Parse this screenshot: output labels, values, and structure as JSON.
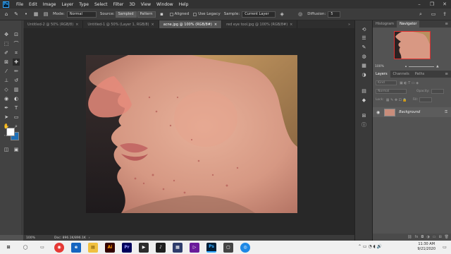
{
  "app": {
    "logo": "Ps"
  },
  "menu": [
    "File",
    "Edit",
    "Image",
    "Layer",
    "Type",
    "Select",
    "Filter",
    "3D",
    "View",
    "Window",
    "Help"
  ],
  "options": {
    "mode_label": "Mode:",
    "mode_value": "Normal",
    "source_label": "Source:",
    "sampled_label": "Sampled",
    "pattern_label": "Pattern",
    "aligned_label": "Aligned",
    "legacy_label": "Use Legacy",
    "sample_label": "Sample:",
    "sample_value": "Current Layer",
    "diffusion_label": "Diffusion:",
    "diffusion_value": "5"
  },
  "tabs": [
    {
      "label": "Untitled-2 @ 50% (RGB/8)",
      "active": false
    },
    {
      "label": "Untitled-1 @ 50% (Layer 1, RGB/8)",
      "active": false
    },
    {
      "label": "acne.jpg @ 100% (RGB/8#)",
      "active": true
    },
    {
      "label": "red eye tool.jpg @ 100% (RGB/8#)",
      "active": false
    }
  ],
  "status": {
    "zoom": "100%",
    "doc": "Doc: 896.1K/896.1K"
  },
  "panels": {
    "top_tabs": [
      "Histogram",
      "Navigator"
    ],
    "nav_zoom": "100%",
    "layer_tabs": [
      "Layers",
      "Channels",
      "Paths"
    ],
    "kind_label": "Kind",
    "blend_mode": "Normal",
    "opacity_label": "Opacity:",
    "lock_label": "Lock:",
    "fill_label": "Fill:",
    "layer_name": "Background"
  },
  "taskbar": {
    "time": "11:30 AM",
    "date": "9/21/2020"
  },
  "colors": {
    "accent": "#31a8ff",
    "foreground": "#ffffff",
    "background": "#1f6fb5"
  }
}
